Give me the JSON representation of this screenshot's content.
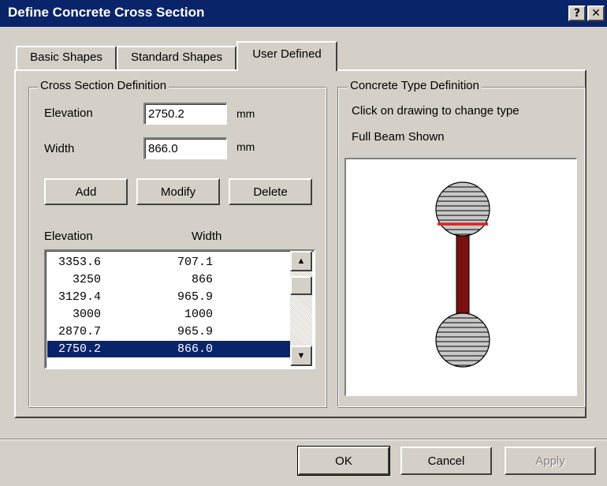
{
  "window": {
    "title": "Define Concrete Cross Section",
    "help_glyph": "?",
    "close_glyph": "✕"
  },
  "tabs": [
    {
      "label": "Basic Shapes",
      "active": false
    },
    {
      "label": "Standard Shapes",
      "active": false
    },
    {
      "label": "User Defined",
      "active": true
    }
  ],
  "cross_section": {
    "legend": "Cross Section Definition",
    "elevation_label": "Elevation",
    "elevation_value": "2750.2",
    "elevation_unit": "mm",
    "width_label": "Width",
    "width_value": "866.0",
    "width_unit": "mm",
    "add_label": "Add",
    "modify_label": "Modify",
    "delete_label": "Delete",
    "col_elevation": "Elevation",
    "col_width": "Width",
    "rows": [
      {
        "elevation": "3353.6",
        "width": "707.1"
      },
      {
        "elevation": "3250",
        "width": "866"
      },
      {
        "elevation": "3129.4",
        "width": "965.9"
      },
      {
        "elevation": "3000",
        "width": "1000"
      },
      {
        "elevation": "2870.7",
        "width": "965.9"
      },
      {
        "elevation": "2750.2",
        "width": "866.0"
      }
    ],
    "selected_index": 5,
    "scroll_up_icon": "▲",
    "scroll_down_icon": "▼"
  },
  "concrete_type": {
    "legend": "Concrete Type Definition",
    "instruction": "Click on drawing to change type",
    "status": "Full Beam Shown"
  },
  "colors": {
    "title_bar": "#0a246a",
    "selection": "#0a246a",
    "web": "#7b1010",
    "marker": "#e02020",
    "flange_fill": "#c8c8c8"
  },
  "footer": {
    "ok_label": "OK",
    "cancel_label": "Cancel",
    "apply_label": "Apply"
  }
}
